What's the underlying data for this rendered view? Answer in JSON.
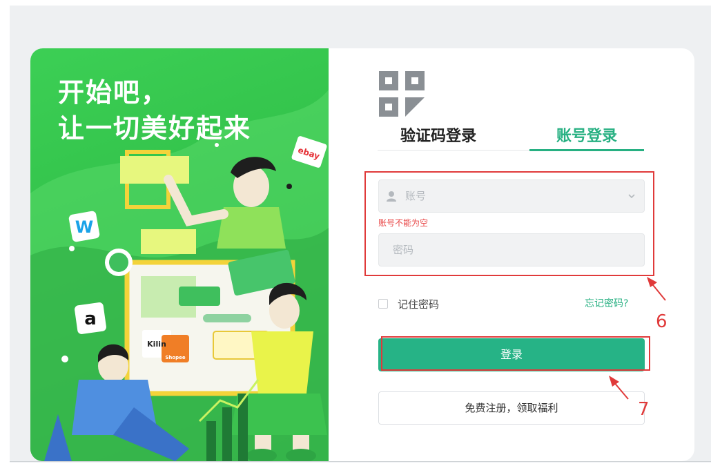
{
  "banner": {
    "title_line1": "开始吧，",
    "title_line2": "让一切美好起来",
    "badge_ebay": "ebay",
    "badge_w": "W",
    "badge_a": "a",
    "badge_kilin": "Kilin",
    "badge_shopee": "Shopee"
  },
  "tabs": {
    "sms_login": "验证码登录",
    "account_login": "账号登录",
    "active": "account_login"
  },
  "form": {
    "account_placeholder": "账号",
    "account_error": "账号不能为空",
    "password_placeholder": "密码",
    "remember_label": "记住密码",
    "remember_checked": false,
    "forgot_link": "忘记密码?",
    "login_button": "登录",
    "register_button": "免费注册，领取福利"
  },
  "annotations": {
    "step6": "6",
    "step7": "7"
  },
  "colors": {
    "accent": "#27b082",
    "button": "#26b386",
    "banner_green": "#3ccf55",
    "error": "#e84545",
    "annotation_red": "#e03a3a"
  },
  "icons": [
    "qr-code-icon",
    "user-icon",
    "chevron-down-icon"
  ]
}
